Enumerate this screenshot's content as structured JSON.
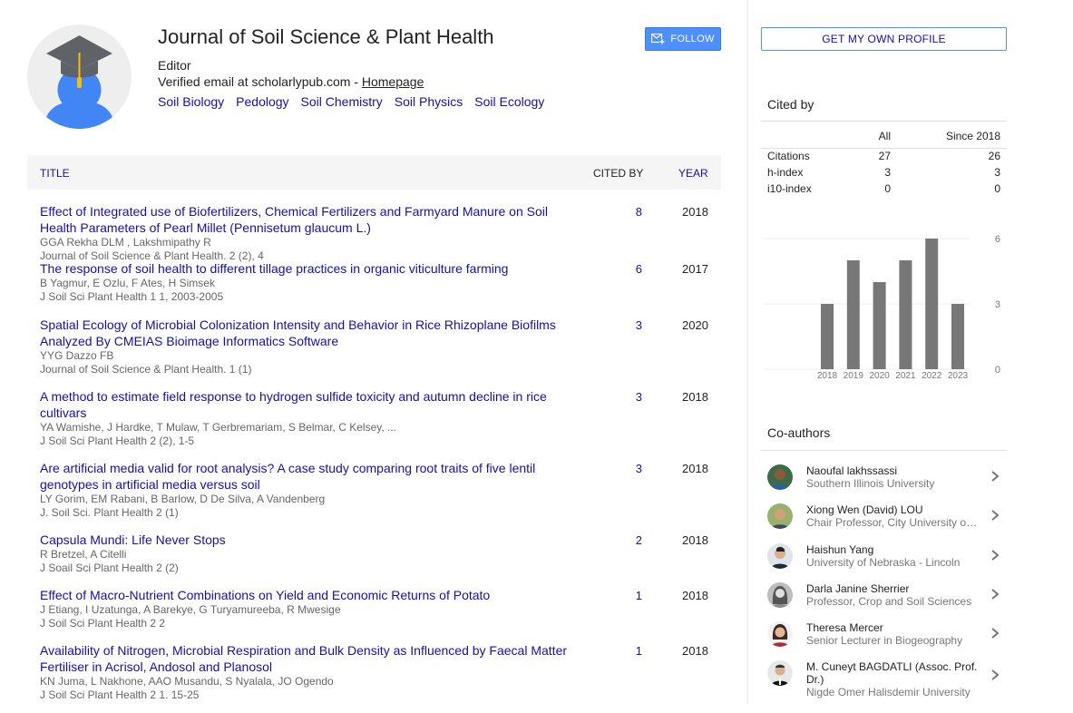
{
  "profile": {
    "name": "Journal of Soil Science & Plant Health",
    "affiliation": "Editor",
    "email_text": "Verified email at scholarlypub.com - ",
    "homepage_label": "Homepage",
    "interests": [
      "Soil Biology",
      "Pedology",
      "Soil Chemistry",
      "Soil Physics",
      "Soil Ecology"
    ],
    "follow_label": "FOLLOW"
  },
  "table": {
    "col_title": "TITLE",
    "col_cited": "CITED BY",
    "col_year": "YEAR",
    "rows": [
      {
        "title": "Effect of Integrated use of Biofertilizers, Chemical Fertilizers and Farmyard Manure on Soil Health Parameters of Pearl Millet (Pennisetum glaucum L.)",
        "authors": "GGA Rekha DLM , Lakshmipathy R",
        "venue": "Journal of Soil Science & Plant Health. 2 (2), 4",
        "cites": "8",
        "year": "2018"
      },
      {
        "title": "The response of soil health to different tillage practices in organic viticulture farming",
        "authors": "B Yagmur, E Ozlu, F Ates, H Simsek",
        "venue": "J Soil Sci Plant Health 1 1, 2003-2005",
        "cites": "6",
        "year": "2017"
      },
      {
        "title": "Spatial Ecology of Microbial Colonization Intensity and Behavior in Rice Rhizoplane Biofilms Analyzed By CMEIAS Bioimage Informatics Software",
        "authors": "YYG Dazzo FB",
        "venue": "Journal of Soil Science & Plant Health. 1 (1)",
        "cites": "3",
        "year": "2020"
      },
      {
        "title": "A method to estimate field response to hydrogen sulfide toxicity and autumn decline in rice cultivars",
        "authors": "YA Wamishe, J Hardke, T Mulaw, T Gerbremariam, S Belmar, C Kelsey, ...",
        "venue": "J Soil Sci Plant Health 2 (2), 1-5",
        "cites": "3",
        "year": "2018"
      },
      {
        "title": "Are artificial media valid for root analysis? A case study comparing root traits of five lentil genotypes in artificial media versus soil",
        "authors": "LY Gorim, EM Rabani, B Barlow, D De Silva, A Vandenberg",
        "venue": "J. Soil Sci. Plant Health 2 (1)",
        "cites": "3",
        "year": "2018"
      },
      {
        "title": "Capsula Mundi: Life Never Stops",
        "authors": "R Bretzel, A Citelli",
        "venue": "J Soail Sci Plant Health 2 (2)",
        "cites": "2",
        "year": "2018"
      },
      {
        "title": "Effect of Macro-Nutrient Combinations on Yield and Economic Returns of Potato",
        "authors": "J Etiang, I Uzatunga, A Barekye, G Turyamureeba, R Mwesige",
        "venue": "J Soil Sci Plant Health 2 2",
        "cites": "1",
        "year": "2018"
      },
      {
        "title": "Availability of Nitrogen, Microbial Respiration and Bulk Density as Influenced by Faecal Matter Fertiliser in Acrisol, Andosol and Planosol",
        "authors": "KN Juma, L Nakhone, AAO Musandu, S Nyalala, JO Ogendo",
        "venue": "J Soil Sci Plant Health 2 1. 15-25",
        "cites": "1",
        "year": "2018"
      }
    ]
  },
  "sidebar": {
    "get_profile_label": "GET MY OWN PROFILE",
    "cited_by_heading": "Cited by",
    "stats_headers": {
      "all": "All",
      "since": "Since 2018"
    },
    "stats": [
      {
        "label": "Citations",
        "all": "27",
        "since": "26"
      },
      {
        "label": "h-index",
        "all": "3",
        "since": "3"
      },
      {
        "label": "i10-index",
        "all": "0",
        "since": "0"
      }
    ],
    "coauthors_heading": "Co-authors",
    "coauthors": [
      {
        "name": "Naoufal lakhssassi",
        "inst": "Southern Illinois University"
      },
      {
        "name": "Xiong Wen (David) LOU",
        "inst": "Chair Professor, City University of Macau"
      },
      {
        "name": "Haishun Yang",
        "inst": "University of Nebraska - Lincoln"
      },
      {
        "name": "Darla Janine Sherrier",
        "inst": "Professor, Crop and Soil Sciences"
      },
      {
        "name": "Theresa Mercer",
        "inst": "Senior Lecturer in Biogeography"
      },
      {
        "name": "M. Cuneyt BAGDATLI (Assoc. Prof. Dr.)",
        "inst": "Nigde Omer Halisdemir University"
      }
    ]
  },
  "colors": {
    "link": "#1a0dab",
    "bar": "#777777",
    "follow_bg": "#4d90fe"
  },
  "chart_data": {
    "type": "bar",
    "categories": [
      "2018",
      "2019",
      "2020",
      "2021",
      "2022",
      "2023"
    ],
    "values": [
      3,
      5,
      4,
      5,
      6,
      3
    ],
    "yticks": [
      "6",
      "3",
      "0"
    ],
    "ylim": [
      0,
      6
    ]
  }
}
